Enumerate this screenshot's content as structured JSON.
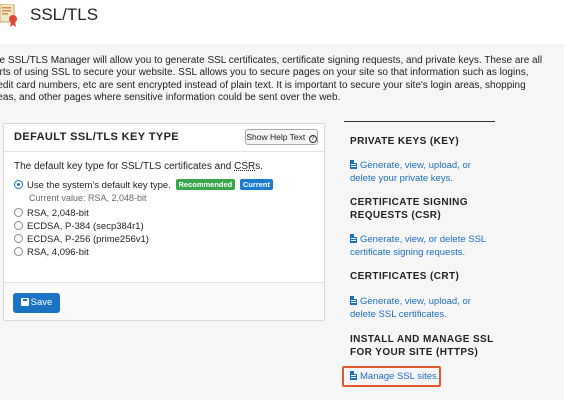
{
  "header": {
    "title": "SSL/TLS",
    "icon": "certificate-icon"
  },
  "intro": {
    "line1": "he SSL/TLS Manager will allow you to generate SSL certificates, certificate signing requests, and private keys. These are all",
    "line2": "arts of using SSL to secure your website. SSL allows you to secure pages on your site so that information such as logins,",
    "line3": "redit card numbers, etc are sent encrypted instead of plain text. It is important to secure your site's login areas, shopping",
    "line4": "reas, and other pages where sensitive information could be sent over the web."
  },
  "key_type_panel": {
    "title": "DEFAULT SSL/TLS KEY TYPE",
    "help_button": "Show Help Text",
    "description_prefix": "The default key type for SSL/TLS certificates and ",
    "description_abbr": "CSR",
    "description_suffix": "s.",
    "options": [
      {
        "label": "Use the system's default key type.",
        "selected": true
      },
      {
        "label": "RSA, 2,048-bit",
        "selected": false
      },
      {
        "label": "ECDSA, P-384 (secp384r1)",
        "selected": false
      },
      {
        "label": "ECDSA, P-256 (prime256v1)",
        "selected": false
      },
      {
        "label": "RSA, 4,096-bit",
        "selected": false
      }
    ],
    "badges": {
      "recommended": "Recommended",
      "current": "Current"
    },
    "current_value": "Current value: RSA, 2,048-bit",
    "save_label": "Save"
  },
  "sidebar": {
    "private_keys": {
      "heading": "PRIVATE KEYS (KEY)",
      "link_line1": "Generate, view, upload, or",
      "link_line2": "delete your private keys."
    },
    "csr": {
      "heading_line1": "CERTIFICATE SIGNING",
      "heading_line2": "REQUESTS (CSR)",
      "link_line1": "Generate, view, or delete SSL",
      "link_line2": "certificate signing requests."
    },
    "crt": {
      "heading": "CERTIFICATES (CRT)",
      "link_line1": "Generate, view, upload, or",
      "link_line2": "delete SSL certificates."
    },
    "install": {
      "heading_line1": "INSTALL AND MANAGE SSL",
      "heading_line2": "FOR YOUR SITE (HTTPS)",
      "link": "Manage SSL sites."
    }
  },
  "colors": {
    "link": "#1b6fbf",
    "save_button": "#1a73c4",
    "recommended_badge": "#3aa64a",
    "current_badge": "#1b7cd0",
    "highlight": "#e05a2b"
  }
}
